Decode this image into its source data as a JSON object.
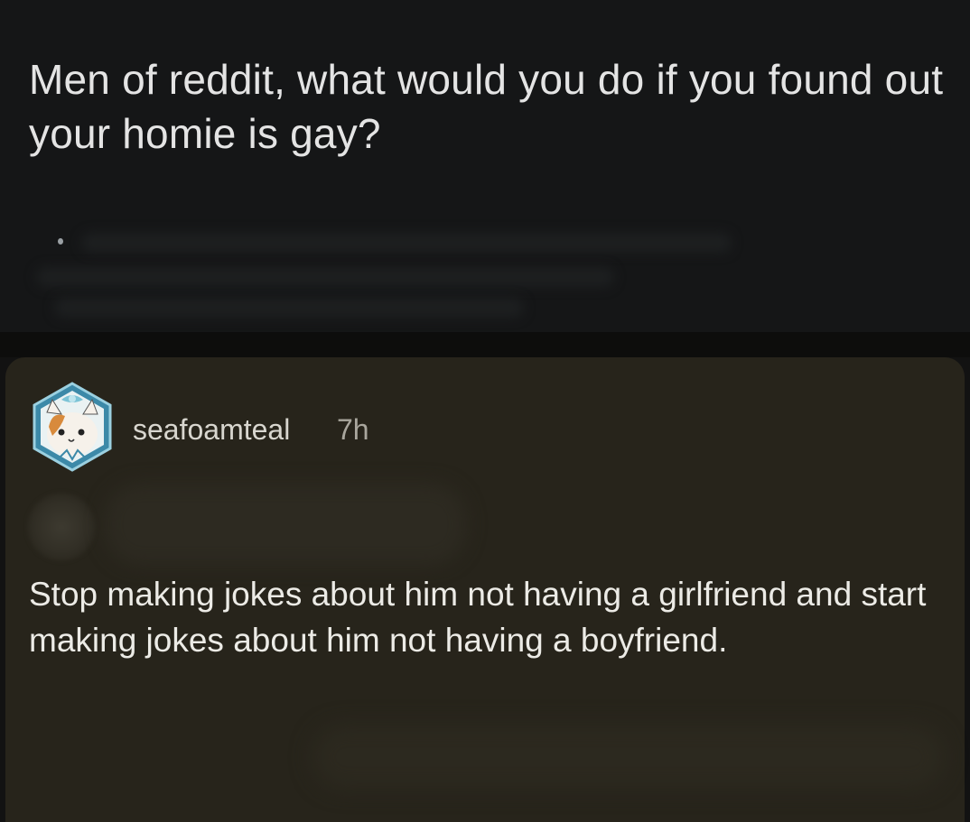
{
  "post": {
    "title": "Men of reddit, what would you do if you found out your homie is gay?"
  },
  "comment": {
    "username": "seafoamteal",
    "timestamp": "7h",
    "avatar_icon": "cat-avatar-icon",
    "body": "Stop making jokes about him not having a girlfriend and start making jokes about him not having a boyfriend."
  },
  "colors": {
    "post_background": "#151617",
    "comment_background": "#27241b",
    "title_text": "#e4e4e4",
    "body_text": "#ecebe6",
    "avatar_ring": "#4a8aa8"
  }
}
